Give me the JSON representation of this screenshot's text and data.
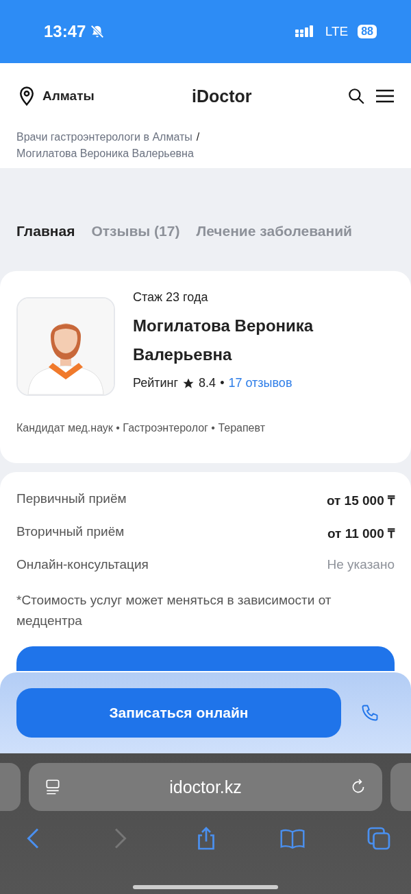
{
  "status_bar": {
    "time": "13:47",
    "silent": true,
    "network": "LTE",
    "battery": "88"
  },
  "header": {
    "city": "Алматы",
    "logo": "iDoctor"
  },
  "breadcrumbs": {
    "separator": "/",
    "items": [
      {
        "label": "Врачи гастроэнтерологи в Алматы"
      },
      {
        "label": "Могилатова Вероника Валерьевна"
      }
    ]
  },
  "tabs": [
    {
      "label": "Главная",
      "selected": true
    },
    {
      "label": "Отзывы (17)",
      "selected": false
    },
    {
      "label": "Лечение заболеваний",
      "selected": false
    }
  ],
  "doctor": {
    "experience": "Стаж 23 года",
    "name": "Могилатова Вероника Валерьевна",
    "rating_label": "Рейтинг",
    "rating": "8.4",
    "separator": "•",
    "reviews_link": "17 отзывов",
    "specialties": "Кандидат мед.наук • Гастроэнтеролог • Терапевт"
  },
  "prices": [
    {
      "service": "Первичный приём",
      "price": "от 15 000 ₸",
      "specified": true
    },
    {
      "service": "Вторичный приём",
      "price": "от 11 000 ₸",
      "specified": true
    },
    {
      "service": "Онлайн-консультация",
      "price": "Не указано",
      "specified": false
    }
  ],
  "price_note": "*Стоимость услуг может меняться в зависимости от медцентра",
  "sticky_bar": {
    "button": "Записаться онлайн"
  },
  "browser": {
    "url": "idoctor.kz"
  }
}
